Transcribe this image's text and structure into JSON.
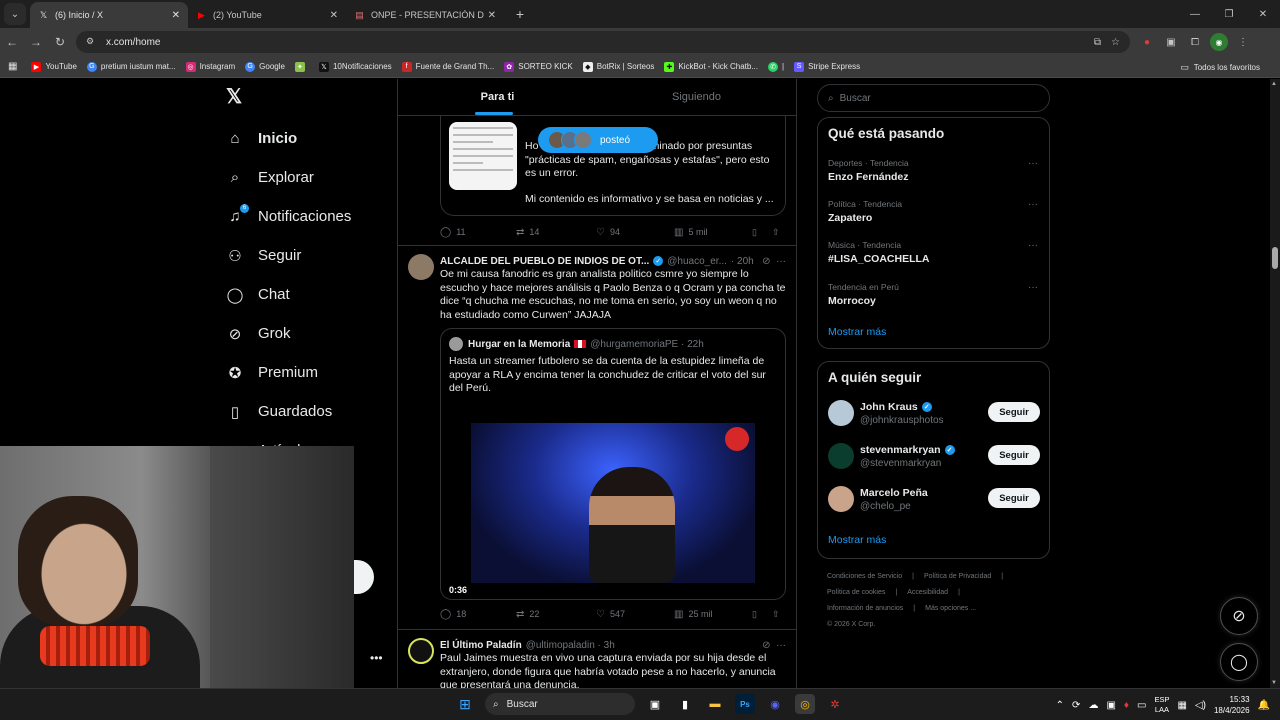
{
  "browser": {
    "tabs": [
      {
        "title": "(6) Inicio / X",
        "icon": "x-logo-icon",
        "active": true
      },
      {
        "title": "(2) YouTube",
        "icon": "youtube-icon",
        "active": false
      },
      {
        "title": "ONPE - PRESENTACIÓN DE RE",
        "icon": "doc-icon",
        "active": false
      }
    ],
    "url": "x.com/home",
    "bookmarks": [
      {
        "label": "YouTube",
        "color": "#ff0000"
      },
      {
        "label": "pretium iustum mat...",
        "color": "#4285f4"
      },
      {
        "label": "Instagram",
        "color": "#d62976"
      },
      {
        "label": "Google",
        "color": "#4285f4"
      },
      {
        "label": "",
        "color": "#8bc34a"
      },
      {
        "label": "10Notificaciones",
        "color": "#111111"
      },
      {
        "label": "Fuente de Grand Th...",
        "color": "#c62828"
      },
      {
        "label": "SORTEO KICK",
        "color": "#8e24aa"
      },
      {
        "label": "BotRix | Sorteos",
        "color": "#eeeeee"
      },
      {
        "label": "KickBot - Kick Chatb...",
        "color": "#53fc18"
      },
      {
        "label": "|",
        "color": "#25d366"
      },
      {
        "label": "Stripe Express",
        "color": "#635bff"
      }
    ],
    "bookmarks_right": "Todos los favoritos"
  },
  "sidebar": {
    "items": [
      {
        "label": "Inicio",
        "icon": "home-icon",
        "glyph": "⌂"
      },
      {
        "label": "Explorar",
        "icon": "search-icon",
        "glyph": "⌕"
      },
      {
        "label": "Notificaciones",
        "icon": "bell-icon",
        "glyph": "🔔"
      },
      {
        "label": "Seguir",
        "icon": "add-user-icon",
        "glyph": "👤"
      },
      {
        "label": "Chat",
        "icon": "chat-icon",
        "glyph": "💬"
      },
      {
        "label": "Grok",
        "icon": "grok-icon",
        "glyph": "⊘"
      },
      {
        "label": "Premium",
        "icon": "premium-icon",
        "glyph": "✪"
      },
      {
        "label": "Guardados",
        "icon": "bookmark-icon",
        "glyph": "🔖"
      },
      {
        "label": "Artículos",
        "icon": "articles-icon",
        "glyph": "▤"
      }
    ],
    "notif_badge": "6"
  },
  "timeline": {
    "tabs": [
      "Para ti",
      "Siguiendo"
    ],
    "posted_pill": "posteó",
    "tweet1": {
      "quote_text": "Ho                                al @SGTRASH_ fue eliminado por presuntas \"prácticas de spam, engañosas y estafas\", pero esto es un error.",
      "quote_text2": "Mi contenido es informativo y se basa en noticias y ...",
      "replies": "11",
      "reposts": "14",
      "likes": "94",
      "views": "5 mil"
    },
    "tweet2": {
      "name": "ALCALDE DEL PUEBLO DE INDIOS DE OT...",
      "handle": "@huaco_er...",
      "time": "· 20h",
      "text": "Oe mi causa fanodric es gran analista politico csmre yo siempre lo escucho y hace mejores análisis q Paolo Benza o q Ocram y pa concha te dice “q chucha me escuchas, no me toma en serio, yo soy un weon q no ha estudiado como Curwen” JAJAJA",
      "quote_name": "Hurgar en la Memoria",
      "quote_handle": "@hurgamemoriaPE · 22h",
      "quote_text": "Hasta un streamer futbolero se da cuenta de la estupidez limeña de apoyar a RLA y encima tener la conchudez de criticar el voto del sur del Perú.",
      "video_duration": "0:36",
      "replies": "18",
      "reposts": "22",
      "likes": "547",
      "views": "25 mil"
    },
    "tweet3": {
      "name": "El Último Paladín",
      "handle": "@ultimopaladin · 3h",
      "text": "Paul Jaimes muestra en vivo una captura enviada por su hija desde el extranjero, donde figura que habría votado pese a no hacerlo, y anuncia que presentará una denuncia."
    }
  },
  "right": {
    "search_placeholder": "Buscar",
    "trending_title": "Qué está pasando",
    "trends": [
      {
        "category": "Deportes · Tendencia",
        "name": "Enzo Fernández"
      },
      {
        "category": "Política · Tendencia",
        "name": "Zapatero"
      },
      {
        "category": "Música · Tendencia",
        "name": "#LISA_COACHELLA"
      },
      {
        "category": "Tendencia en Perú",
        "name": "Morrocoy"
      }
    ],
    "show_more": "Mostrar más",
    "who_title": "A quién seguir",
    "who": [
      {
        "name": "John Kraus",
        "handle": "@johnkrausphotos",
        "verified": true,
        "button": "Seguir",
        "color": "#b7c9d6"
      },
      {
        "name": "stevenmarkryan",
        "handle": "@stevenmarkryan",
        "verified": true,
        "button": "Seguir",
        "color": "#0b3d2e"
      },
      {
        "name": "Marcelo Peña",
        "handle": "@chelo_pe",
        "verified": false,
        "button": "Seguir",
        "color": "#c9a48a"
      }
    ],
    "footer": [
      "Condiciones de Servicio",
      "|",
      "Política de Privacidad",
      "|",
      "Política de cookies",
      "|",
      "Accesibilidad",
      "|",
      "Información de anuncios",
      "|",
      "Más opciones ...",
      "© 2026 X Corp."
    ]
  },
  "taskbar": {
    "search": "Buscar",
    "lang": "ESP",
    "lang2": "LAA",
    "time": "15:33",
    "date": "18/4/2026"
  }
}
